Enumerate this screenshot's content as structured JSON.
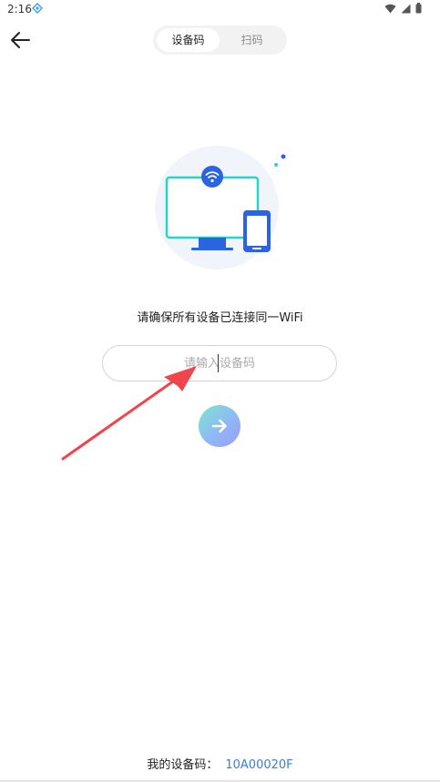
{
  "status_bar": {
    "time": "2:16"
  },
  "tabs": [
    {
      "label": "设备码",
      "active": true
    },
    {
      "label": "扫码",
      "active": false
    }
  ],
  "tip": "请确保所有设备已连接同一WiFi",
  "input": {
    "value": "",
    "placeholder": "请输入设备码"
  },
  "footer": {
    "label": "我的设备码：",
    "code": "10A00020F"
  },
  "colors": {
    "accent": "#3a7fd9",
    "monitor": "#28d3c9",
    "phone": "#2c64e0",
    "annotation": "#f0454c"
  },
  "icons": {
    "back": "arrow-left-icon",
    "submit": "arrow-right-icon",
    "wifi": "wifi-icon",
    "battery": "battery-icon"
  }
}
